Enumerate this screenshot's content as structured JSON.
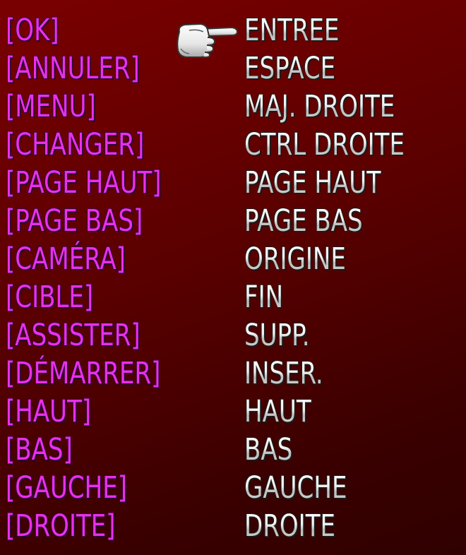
{
  "bindings": [
    {
      "action": "[OK]",
      "key": "ENTREE"
    },
    {
      "action": "[ANNULER]",
      "key": "ESPACE"
    },
    {
      "action": "[MENU]",
      "key": "MAJ. DROITE"
    },
    {
      "action": "[CHANGER]",
      "key": "CTRL DROITE"
    },
    {
      "action": "[PAGE HAUT]",
      "key": "PAGE HAUT"
    },
    {
      "action": "[PAGE BAS]",
      "key": "PAGE BAS"
    },
    {
      "action": "[CAMÉRA]",
      "key": "ORIGINE"
    },
    {
      "action": "[CIBLE]",
      "key": "FIN"
    },
    {
      "action": "[ASSISTER]",
      "key": "SUPP."
    },
    {
      "action": "[DÉMARRER]",
      "key": "INSER."
    },
    {
      "action": "[HAUT]",
      "key": "HAUT"
    },
    {
      "action": "[BAS]",
      "key": "BAS"
    },
    {
      "action": "[GAUCHE]",
      "key": "GAUCHE"
    },
    {
      "action": "[DROITE]",
      "key": "DROITE"
    }
  ],
  "cursor": {
    "icon": "pointing-hand-icon",
    "selected_index": 0
  },
  "colors": {
    "action_text": "#e830e8",
    "key_text": "#f4f4f4",
    "background": "#5a0000"
  }
}
